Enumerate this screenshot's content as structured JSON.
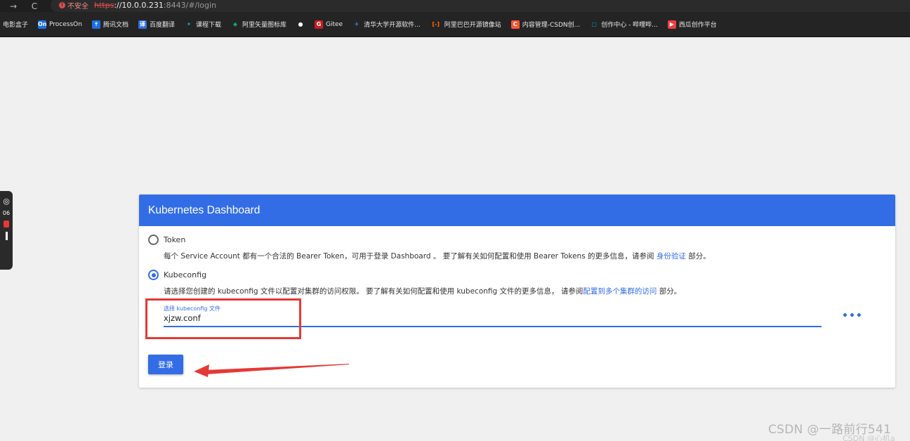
{
  "browser": {
    "nav": {
      "forward": "→",
      "reload": "C"
    },
    "security_label": "不安全",
    "url_scheme": "https",
    "url_host": "://10.0.0.231",
    "url_rest": ":8443/#/login"
  },
  "bookmarks": [
    {
      "label": "电影盒子",
      "icon": "",
      "color": ""
    },
    {
      "label": "ProcessOn",
      "icon": "On",
      "color": "#1e6fe3"
    },
    {
      "label": "腾讯文档",
      "icon": "✝",
      "color": "#1e6fe3"
    },
    {
      "label": "百度翻译",
      "icon": "译",
      "color": "#2f6fe4"
    },
    {
      "label": "课程下载",
      "icon": "✦",
      "color": "#18a0c6"
    },
    {
      "label": "阿里矢量图标库",
      "icon": "◆",
      "color": "#15a36a"
    },
    {
      "label": "",
      "icon": "●",
      "color": "#ffffff"
    },
    {
      "label": "Gitee",
      "icon": "G",
      "color": "#c71d23"
    },
    {
      "label": "清华大学开源软件...",
      "icon": "✈",
      "color": "#3b8ee8"
    },
    {
      "label": "阿里巴巴开源镜像站",
      "icon": "[-]",
      "color": "#ff6a00"
    },
    {
      "label": "内容管理-CSDN创...",
      "icon": "C",
      "color": "#fc5531"
    },
    {
      "label": "创作中心 - 哔哩哔...",
      "icon": "▢",
      "color": "#00a1d6"
    },
    {
      "label": "西瓜创作平台",
      "icon": "▶",
      "color": "#f03d3d"
    }
  ],
  "side_widget": {
    "text": "06"
  },
  "card": {
    "title": "Kubernetes Dashboard",
    "token_label": "Token",
    "token_desc_pre": "每个 Service Account 都有一个合法的 Bearer Token，可用于登录 Dashboard 。 要了解有关如何配置和使用 Bearer Tokens 的更多信息，请参阅 ",
    "token_desc_link": "身份验证",
    "token_desc_post": " 部分。",
    "kubeconfig_label": "Kubeconfig",
    "kube_desc_pre": "请选择您创建的 kubeconfig 文件以配置对集群的访问权限。 要了解有关如何配置和使用 kubeconfig 文件的更多信息， 请参阅",
    "kube_desc_link": "配置到多个集群的访问",
    "kube_desc_post": " 部分。",
    "file_label": "选择 kubeconfig 文件",
    "file_value": "xjzw.conf",
    "more": "•••",
    "login": "登录",
    "selected_option": "Kubeconfig"
  },
  "watermark": "CSDN @一路前行541",
  "watermark2": "CSDN @心机a"
}
